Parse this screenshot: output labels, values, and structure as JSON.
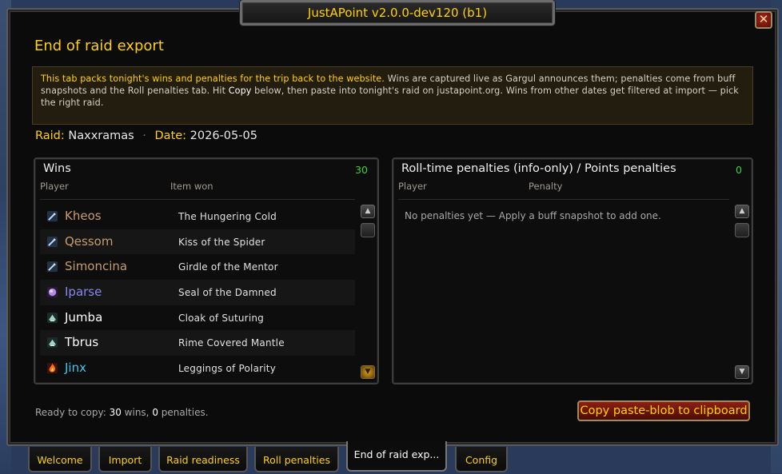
{
  "window": {
    "title": "JustAPoint  v2.0.0-dev120 (b1)",
    "close_label": "✕"
  },
  "page": {
    "heading": "End of raid export",
    "info": {
      "part1": "This tab packs tonight's wins and penalties for the trip back to the website.",
      "part2": "  Wins are captured live as Gargul announces them; penalties come from buff snapshots and the Roll penalties tab. Hit ",
      "copy_word": "Copy",
      "part3": " below, then paste into tonight's raid on justapoint.org. Wins from other dates get filtered at import — pick the right raid."
    },
    "raid_label": "Raid:",
    "raid_value": "Naxxramas",
    "separator": "·",
    "date_label": "Date:",
    "date_value": "2026-05-05"
  },
  "wins": {
    "title": "Wins",
    "count": "30",
    "col_player": "Player",
    "col_item": "Item won",
    "rows": [
      {
        "player": "Kheos",
        "item": "The Hungering Cold",
        "color": "#c79c6e",
        "icon": "sword-icon"
      },
      {
        "player": "Qessom",
        "item": "Kiss of the Spider",
        "color": "#c79c6e",
        "icon": "sword-icon"
      },
      {
        "player": "Simoncina",
        "item": "Girdle of the Mentor",
        "color": "#c79c6e",
        "icon": "sword-icon"
      },
      {
        "player": "Iparse",
        "item": "Seal of the Damned",
        "color": "#8788ee",
        "icon": "purple-orb-icon"
      },
      {
        "player": "Jumba",
        "item": "Cloak of Suturing",
        "color": "#ffffff",
        "icon": "cloth-icon"
      },
      {
        "player": "Tbrus",
        "item": "Rime Covered Mantle",
        "color": "#ffffff",
        "icon": "cloth-icon"
      },
      {
        "player": "Jinx",
        "item": "Leggings of Polarity",
        "color": "#3fc7eb",
        "icon": "fire-icon"
      }
    ]
  },
  "penalties": {
    "title": "Roll-time penalties (info-only) / Points penalties",
    "count": "0",
    "col_player": "Player",
    "col_penalty": "Penalty",
    "empty": "No penalties yet — Apply a buff snapshot to add one."
  },
  "footer": {
    "status_prefix": "Ready to copy: ",
    "wins_count": "30",
    "wins_word": " wins, ",
    "penalties_count": "0",
    "penalties_word": " penalties.",
    "copy_button": "Copy paste-blob to clipboard"
  },
  "tabs": [
    {
      "label": "Welcome",
      "active": false
    },
    {
      "label": "Import",
      "active": false
    },
    {
      "label": "Raid readiness",
      "active": false
    },
    {
      "label": "Roll penalties",
      "active": false
    },
    {
      "label": "End of raid exp...",
      "active": true
    },
    {
      "label": "Config",
      "active": false
    }
  ],
  "colors": {
    "gold": "#ffd100",
    "win_count": "#3fd23f",
    "copy_button_bg": "#8f1e12"
  }
}
